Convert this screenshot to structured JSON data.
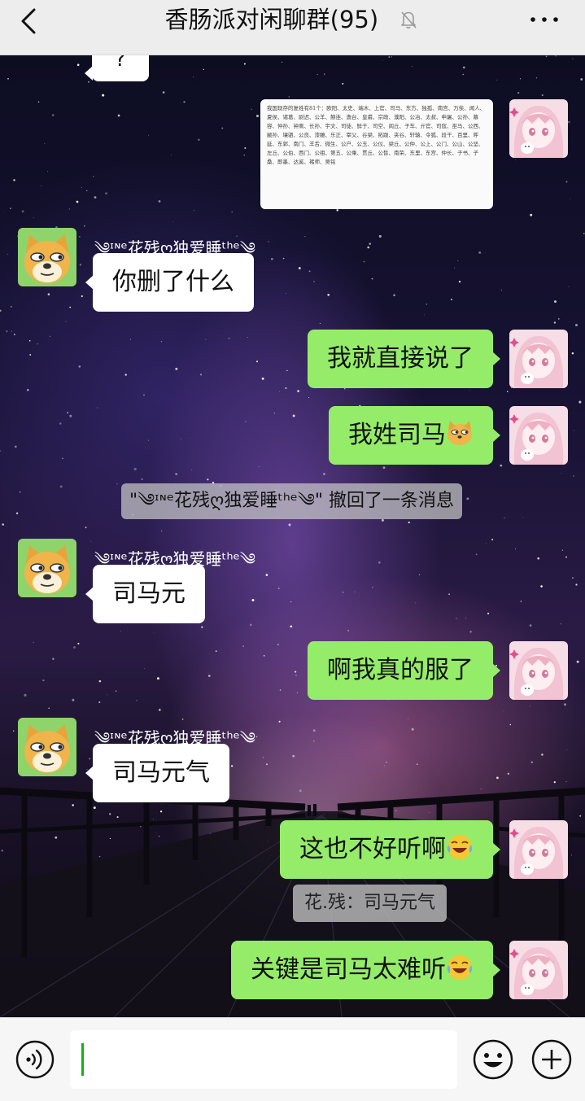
{
  "header": {
    "title": "香肠派对闲聊群(95)",
    "back_icon": "chevron-left-icon",
    "mute_icon": "bell-off-icon",
    "more_icon": "more-dots-icon"
  },
  "colors": {
    "header_bg": "#ededed",
    "outgoing_bubble": "#95ec69",
    "incoming_bubble": "#ffffff",
    "caret": "#1aad19"
  },
  "messages": {
    "partial_top": {
      "text": "?"
    },
    "image_doc": {
      "text": "我国现存的复姓有81个：欧阳、太史、端木、上官、司马、东方、独孤、南宫、万俟、闻人、夏侯、诸葛、尉迟、公羊、赫连、澹台、皇甫、宗政、濮阳、公冶、太叔、申屠、公孙、慕容、仲孙、钟离、长孙、宇文、司徒、鲜于、司空、闾丘、子车、亓官、司寇、巫马、公西、颛孙、壤驷、公良、漆雕、乐正、宰父、谷梁、拓跋、夹谷、轩辕、令狐、段干、百里、呼延、东郭、南门、羊舌、微生、公户、公玉、公仪、梁丘、公仲、公上、公门、公山、公坚、左丘、公伯、西门、公祖、第五、公乘、贯丘、公皙、南荣、东里、东宫、仲长、子书、子桑、即墨、达奚、褚师、吴铭"
    },
    "m1": {
      "sender": "༄ᶦᶰᵉ花残ღ独爱睡ᵗʰᵉ༄",
      "text": "你删了什么"
    },
    "m2": {
      "text": "我就直接说了"
    },
    "m3": {
      "text": "我姓司马",
      "emoji": "doge-emoji"
    },
    "recall": {
      "text": "\"༄ᶦᶰᵉ花残ღ独爱睡ᵗʰᵉ༄\" 撤回了一条消息"
    },
    "m4": {
      "sender": "༄ᶦᶰᵉ花残ღ独爱睡ᵗʰᵉ༄",
      "text": "司马元"
    },
    "m5": {
      "text": "啊我真的服了"
    },
    "m6": {
      "sender": "༄ᶦᶰᵉ花残ღ独爱睡ᵗʰᵉ༄",
      "text": "司马元气"
    },
    "m7": {
      "text": "这也不好听啊",
      "emoji": "laugh-cry-emoji"
    },
    "m7_quote": {
      "text": "花.残：司马元气"
    },
    "m8": {
      "text": "关键是司马太难听",
      "emoji": "laugh-cry-emoji"
    }
  },
  "avatars": {
    "incoming": "doge-avatar",
    "outgoing": "anime-girl-avatar"
  },
  "input_bar": {
    "voice_icon": "voice-icon",
    "emoji_icon": "smiley-icon",
    "plus_icon": "plus-icon",
    "value": ""
  }
}
